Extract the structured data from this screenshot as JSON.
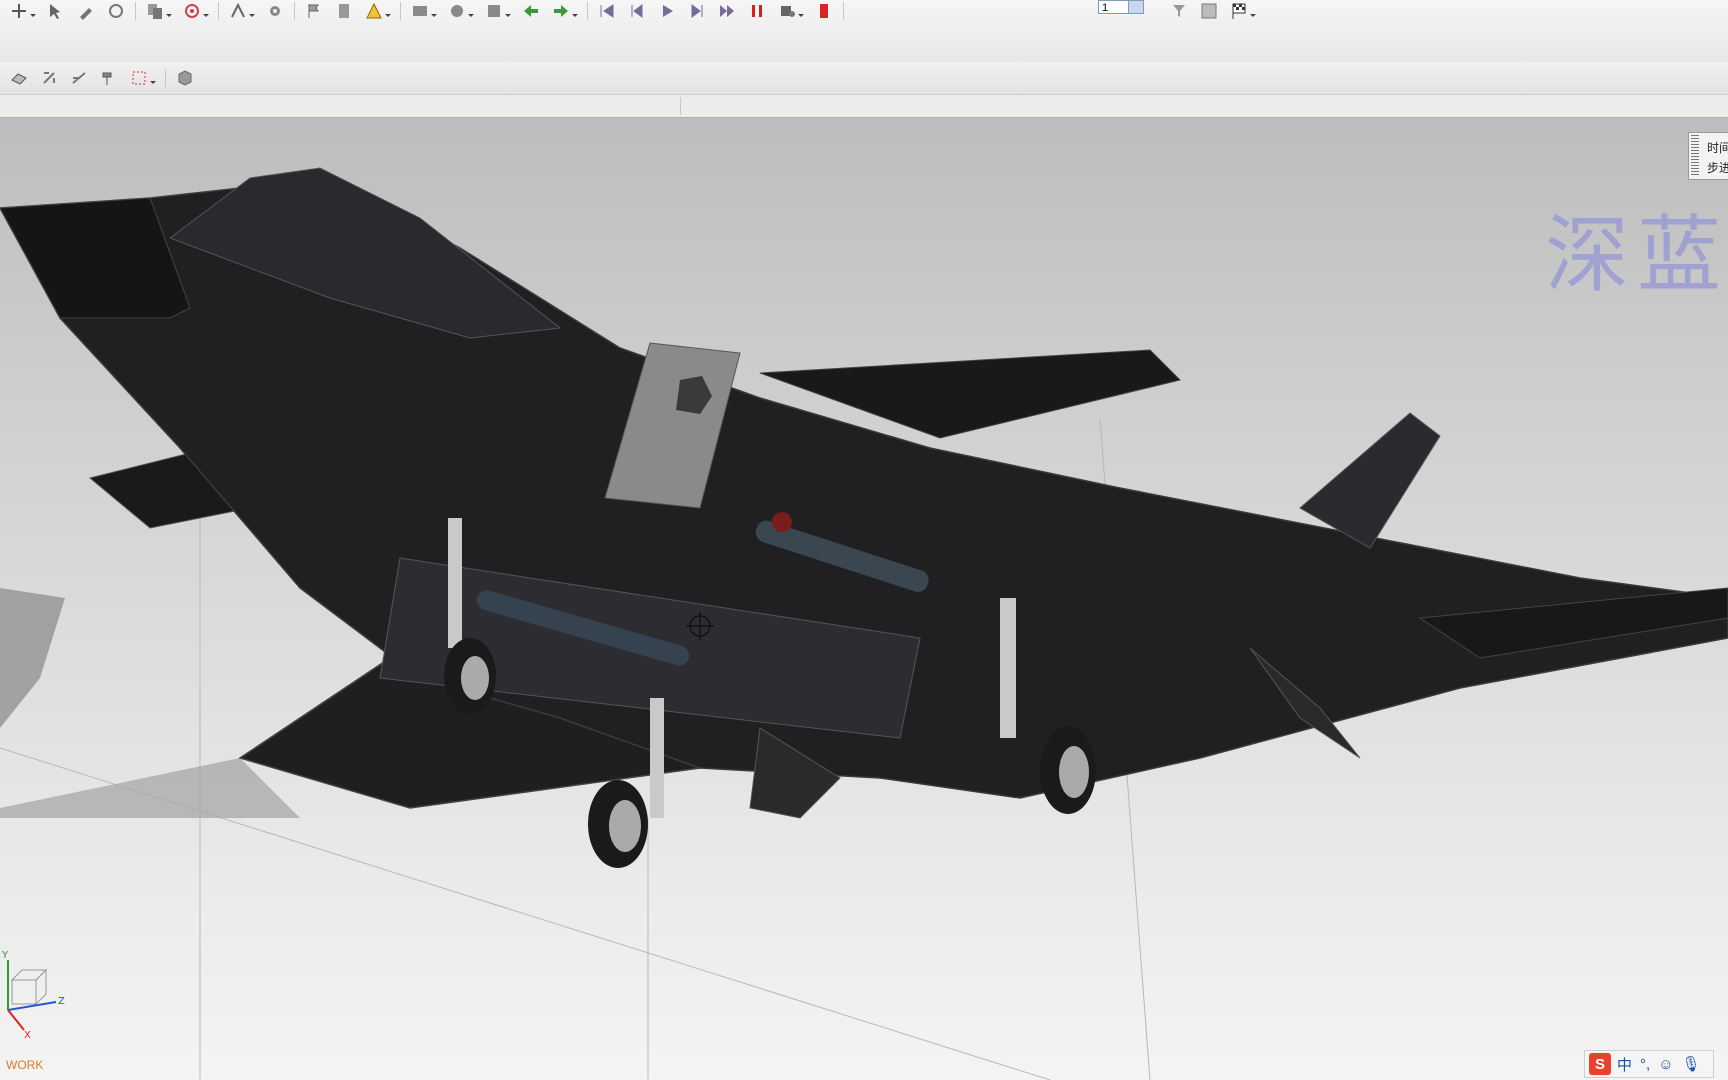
{
  "toolbar": {
    "step_value": "1"
  },
  "motion_panel": {
    "line1": "时间",
    "line2": "步进"
  },
  "watermark": "深蓝",
  "status": {
    "work_label": "WORK"
  },
  "triad": {
    "y_label": "Y",
    "z_label": "Z",
    "x_label": "X"
  },
  "ime": {
    "logo": "S",
    "mode": "中",
    "punct": "°,",
    "emoji": "☺",
    "voice": "🎙"
  },
  "colors": {
    "accent_orange": "#f0a35a",
    "aircraft_dark": "#1f1f22",
    "viewport_top": "#bdbdbd",
    "viewport_bottom": "#f4f4f4",
    "watermark": "#8c8fd8"
  }
}
